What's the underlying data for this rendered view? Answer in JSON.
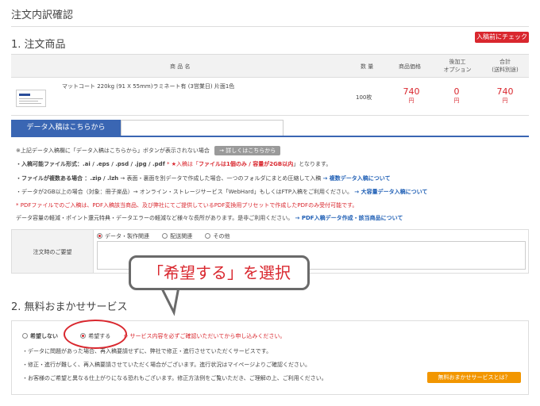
{
  "page_title": "注文内訳確認",
  "section1": {
    "title": "1. 注文商品",
    "check_button": "入稿前にチェック",
    "headers": {
      "name": "商 品 名",
      "qty": "数 量",
      "price": "商品価格",
      "option_l1": "後加工",
      "option_l2": "オプション",
      "total_l1": "合計",
      "total_l2": "(送料別途)"
    },
    "row": {
      "name": "マットコート 220kg (91 X 55mm)ラミネート有 (3営業日) 片面1色",
      "qty": "100枚",
      "price": "740",
      "option": "0",
      "total": "740",
      "yen": "円"
    }
  },
  "upload_tab": "データ入稿はこちらから",
  "notes": {
    "line1_text": "※上記データ入稿欄に「データ入稿はこちらから」ボタンが表示されない場合",
    "line1_button": "→ 詳しくはこちらから",
    "line2_label": "・入稿可能ファイル形式：.ai / .eps / .psd / .jpg / .pdf",
    "line2_mid": "* ★入稿は「",
    "line2_red": "ファイルは1個のみ / 容量が2GB以内",
    "line2_end": "」となります。",
    "line3_label": "・ファイルが複数ある場合 ：.zip / .lzh",
    "line3_text": "→ 表面・裏面を別データで作成した場合、一つのフォルダにまとめ圧縮して入稿",
    "line3_link": "→ 複数データ入稿について",
    "line4_text": "・データが2GB以上の場合（対象：冊子楽品）→ オンライン・ストレージサービス「WebHard」もしくはFTP入稿をご利用ください。",
    "line4_link": "→ 大容量データ入稿について",
    "line5_red": "* PDFファイルでのご入稿は、PDF入稿該当商品、及び弊社にてご提供しているPDF変換用プリセットで作成したPDFのみ受付可能です。",
    "line6_text": "データ容量の軽減・ポイント還元特典・データエラーの軽減など様々な長所があります。是非ご利用ください。",
    "line6_link": "→ PDF入稿データ作成・該当商品について"
  },
  "request": {
    "label": "注文時のご要望",
    "options": [
      "データ・製作関連",
      "配送関連",
      "その他"
    ]
  },
  "section2": {
    "title": "2. 無料おまかせサービス",
    "option_no": "希望しない",
    "option_yes": "希望する",
    "notice": "※ サービス内容を必ずご確認いただいてから申し込みください。",
    "bullets": [
      "・データに問題があった場合、再入稿要請せずに、弊社で修正・進行させていただくサービスです。",
      "・修正・進行が難しく、再入稿要請させていただく場合がございます。進行状況はマイページよりご確認ください。",
      "・お客様のご希望と異なる仕上がりになる恐れもございます。修正方法例をご覧いただき、ご理解の上、ご利用ください。"
    ],
    "info_button": "無料おまかせサービスとは？"
  },
  "callout": "「希望する」を選択"
}
